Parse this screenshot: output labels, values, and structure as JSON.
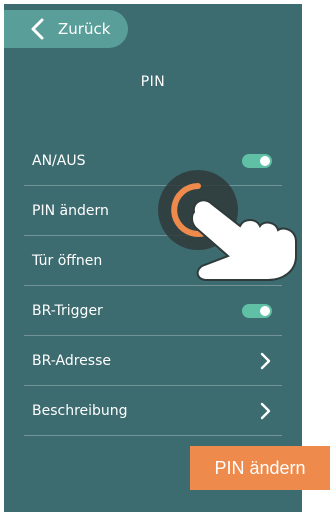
{
  "header": {
    "back_label": "Zurück",
    "title": "PIN"
  },
  "settings": {
    "items": [
      {
        "label": "AN/AUS",
        "control": "toggle",
        "value": "on"
      },
      {
        "label": "PIN ändern",
        "control": "none"
      },
      {
        "label": "Tür öffnen",
        "control": "none"
      },
      {
        "label": "BR-Trigger",
        "control": "toggle",
        "value": "on"
      },
      {
        "label": "BR-Adresse",
        "control": "chevron"
      },
      {
        "label": "Beschreibung",
        "control": "chevron"
      }
    ]
  },
  "caption": {
    "text": "PIN ändern"
  },
  "icons": {
    "back": "chevron-left-icon",
    "toggle": "toggle-switch-icon",
    "chevron": "chevron-right-icon",
    "tap": "tap-hand-icon"
  },
  "colors": {
    "background": "#3c6b70",
    "back_button": "#5a9e99",
    "toggle_on": "#5fc0a6",
    "caption_bg": "#ee8a4c",
    "tap_ring": "#ee8a4c"
  }
}
